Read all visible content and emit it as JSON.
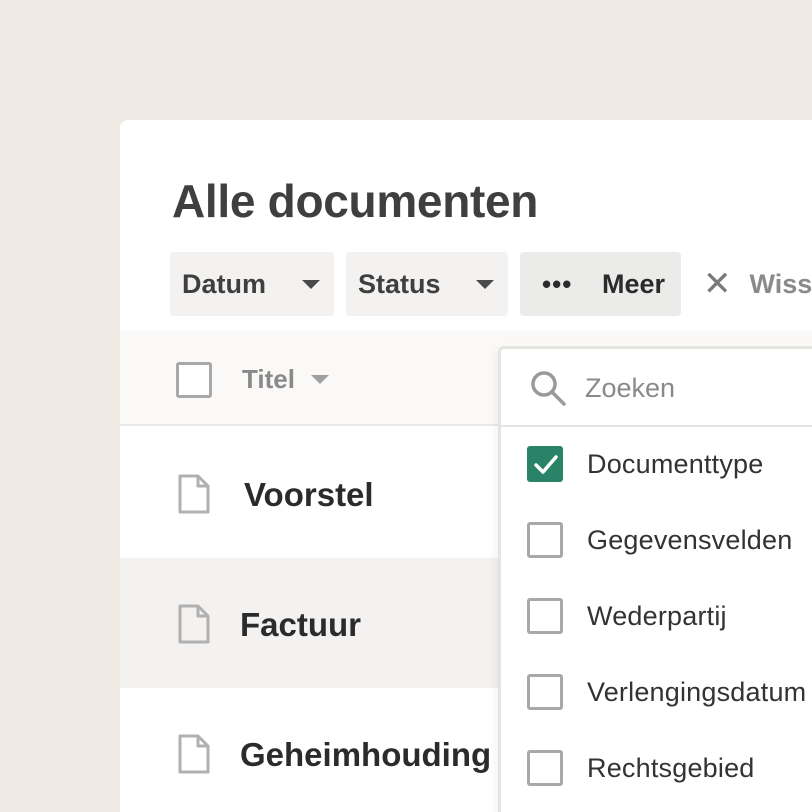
{
  "page": {
    "title": "Alle documenten"
  },
  "filters": {
    "datum_label": "Datum",
    "status_label": "Status",
    "more_label": "Meer",
    "clear_label": "Wiss"
  },
  "table": {
    "column_title": "Titel",
    "rows": [
      {
        "label": "Voorstel"
      },
      {
        "label": "Factuur"
      },
      {
        "label": "Geheimhouding"
      }
    ]
  },
  "dropdown": {
    "search_placeholder": "Zoeken",
    "options": [
      {
        "label": "Documenttype",
        "checked": true
      },
      {
        "label": "Gegevensvelden",
        "checked": false
      },
      {
        "label": "Wederpartij",
        "checked": false
      },
      {
        "label": "Verlengingsdatum",
        "checked": false
      },
      {
        "label": "Rechtsgebied",
        "checked": false
      }
    ]
  },
  "colors": {
    "background": "#efebe4",
    "accent_checkbox": "#2a8366"
  },
  "icons": {
    "caret": "caret-down-icon",
    "more": "more-dots-icon",
    "clear": "close-icon",
    "document": "document-icon",
    "search": "search-icon",
    "check": "checkmark-icon"
  }
}
